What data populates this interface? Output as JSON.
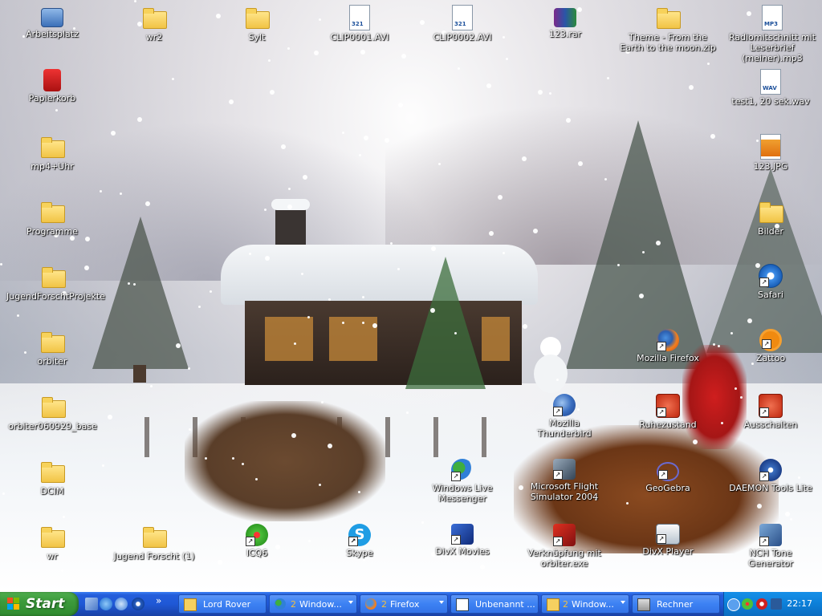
{
  "desktop_icons": {
    "arbeitsplatz": "Arbeitsplatz",
    "wr2": "wr2",
    "sylt": "Sylt",
    "clip1": "CLIP0001.AVI",
    "clip2": "CLIP0002.AVI",
    "rar": "123.rar",
    "theme": "Theme - From the Earth to the moon.zip",
    "radio": "Radiomitschnitt mit Leserbrief (meiner).mp3",
    "papierkorb": "Papierkorb",
    "test": "test1, 20 sek.wav",
    "mp4uhr": "mp4+Uhr",
    "jpg": "123.JPG",
    "programme": "Programme",
    "bilder": "Bilder",
    "jugend": "JugendForschtProjekte",
    "safari": "Safari",
    "orbiter": "orbiter",
    "firefox": "Mozilla Firefox",
    "zattoo": "Zattoo",
    "orbiter2": "orbiter060929_base",
    "thunderbird": "Mozilla Thunderbird",
    "ruhe": "Ruhezustand",
    "aus": "Ausschalten",
    "dcim": "DCIM",
    "wlm": "Windows Live Messenger",
    "flightsim": "Microsoft Flight Simulator 2004",
    "geogebra": "GeoGebra",
    "daemon": "DAEMON Tools Lite",
    "wr": "wr",
    "jugend1": "Jugend Forscht (1)",
    "icq": "ICQ6",
    "skype": "Skype",
    "divxmovies": "DivX Movies",
    "verkn": "Verknüpfung mit orbiter.exe",
    "divxplayer": "DivX Player",
    "nch": "NCH Tone Generator"
  },
  "taskbar": {
    "start_label": "Start",
    "quicklaunch_more": "»",
    "tasks": [
      {
        "count": "",
        "label": "Lord Rover"
      },
      {
        "count": "2",
        "label": "Window..."
      },
      {
        "count": "2",
        "label": "Firefox"
      },
      {
        "count": "",
        "label": "Unbenannt ..."
      },
      {
        "count": "2",
        "label": "Window..."
      },
      {
        "count": "",
        "label": "Rechner"
      }
    ],
    "clock": "22:17"
  }
}
